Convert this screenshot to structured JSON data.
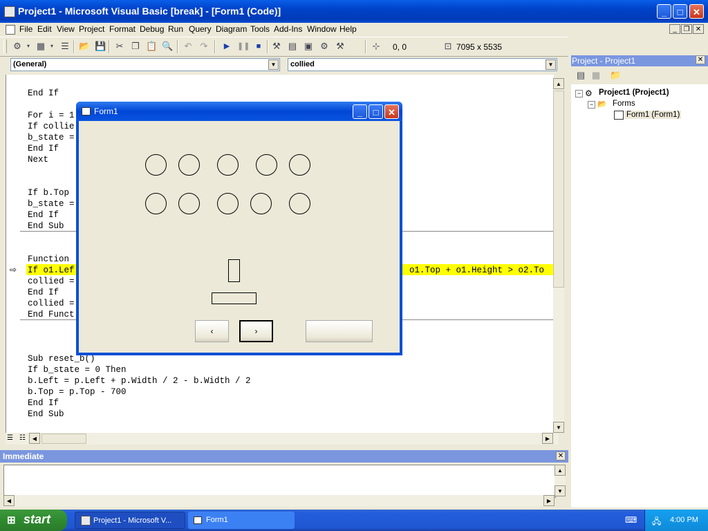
{
  "window": {
    "title": "Project1 - Microsoft Visual Basic [break] - [Form1 (Code)]",
    "minimize": "_",
    "maximize": "□",
    "close": "✕"
  },
  "menu": [
    "File",
    "Edit",
    "View",
    "Project",
    "Format",
    "Debug",
    "Run",
    "Query",
    "Diagram",
    "Tools",
    "Add-Ins",
    "Window",
    "Help"
  ],
  "toolbar": {
    "position": "0, 0",
    "size": "7095 x 5535"
  },
  "code": {
    "object_combo": "(General)",
    "proc_combo": "collied",
    "lines": [
      "End If",
      "",
      "For i = 1",
      "If collie",
      "b_state =",
      "End If",
      "Next",
      "",
      "",
      "If b.Top",
      "b_state =",
      "End If",
      "End Sub",
      "",
      "",
      "Function",
      "If o1.Lef",
      "collied =",
      "End If",
      "collied =",
      "End Funct",
      "",
      "",
      "",
      "Sub reset_b()",
      "If b_state = 0 Then",
      "b.Left = p.Left + p.Width / 2 - b.Width / 2",
      "b.Top = p.Top - 700",
      "End If",
      "End Sub"
    ],
    "highlight_tail": "o1.Top + o1.Height > o2.To"
  },
  "form1": {
    "title": "Form1",
    "btn_left": "‹",
    "btn_right": "›",
    "btn_blank": ""
  },
  "project": {
    "title": "Project - Project1",
    "root": "Project1 (Project1)",
    "folder": "Forms",
    "item": "Form1 (Form1)"
  },
  "immediate": {
    "title": "Immediate"
  },
  "taskbar": {
    "start": "start",
    "tasks": [
      "Project1 - Microsoft V...",
      "Form1"
    ],
    "clock": "4:00 PM"
  }
}
